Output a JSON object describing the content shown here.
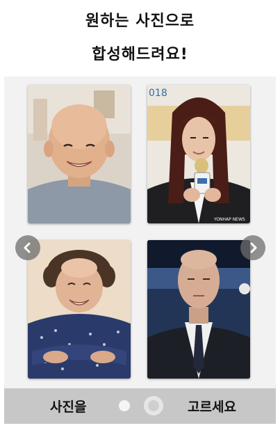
{
  "header": {
    "line1": "원하는 사진으로",
    "line2": "합성해드려요!"
  },
  "gallery": {
    "photos": [
      {
        "name": "bald-smiling-man"
      },
      {
        "name": "long-hair-man-with-microphone"
      },
      {
        "name": "curly-hair-man-arms-crossed"
      },
      {
        "name": "man-in-suit"
      }
    ],
    "photo2_watermark_top": "018",
    "photo2_watermark_bottom": "YONHAP NEWS"
  },
  "footer": {
    "left_label": "사진을",
    "right_label": "고르세요",
    "page_count": 2,
    "current_page": 2
  },
  "colors": {
    "gallery_bg": "#f2f2f2",
    "footer_bg": "#c7c7c7",
    "arrow_bg": "#6e6e6e"
  }
}
